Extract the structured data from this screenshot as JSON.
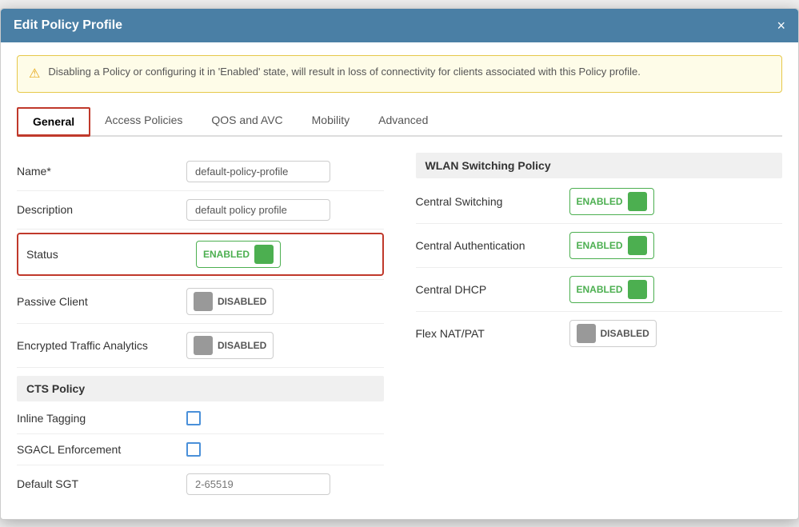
{
  "modal": {
    "title": "Edit Policy Profile",
    "close_icon": "×"
  },
  "alert": {
    "icon": "⚠",
    "message": "Disabling a Policy or configuring it in 'Enabled' state, will result in loss of connectivity for clients associated with this Policy profile."
  },
  "tabs": [
    {
      "id": "general",
      "label": "General",
      "active": true
    },
    {
      "id": "access-policies",
      "label": "Access Policies",
      "active": false
    },
    {
      "id": "qos-avc",
      "label": "QOS and AVC",
      "active": false
    },
    {
      "id": "mobility",
      "label": "Mobility",
      "active": false
    },
    {
      "id": "advanced",
      "label": "Advanced",
      "active": false
    }
  ],
  "form": {
    "name_label": "Name*",
    "name_value": "default-policy-profile",
    "description_label": "Description",
    "description_value": "default policy profile",
    "status_label": "Status",
    "status_toggle_label": "ENABLED",
    "passive_client_label": "Passive Client",
    "passive_client_toggle_label": "DISABLED",
    "encrypted_traffic_label": "Encrypted Traffic Analytics",
    "encrypted_traffic_toggle_label": "DISABLED"
  },
  "cts_policy": {
    "header": "CTS Policy",
    "inline_tagging_label": "Inline Tagging",
    "sgacl_enforcement_label": "SGACL Enforcement",
    "default_sgt_label": "Default SGT",
    "default_sgt_placeholder": "2-65519"
  },
  "wlan_switching": {
    "header": "WLAN Switching Policy",
    "central_switching_label": "Central Switching",
    "central_switching_toggle": "ENABLED",
    "central_authentication_label": "Central Authentication",
    "central_authentication_toggle": "ENABLED",
    "central_dhcp_label": "Central DHCP",
    "central_dhcp_toggle": "ENABLED",
    "flex_nat_label": "Flex NAT/PAT",
    "flex_nat_toggle": "DISABLED"
  }
}
